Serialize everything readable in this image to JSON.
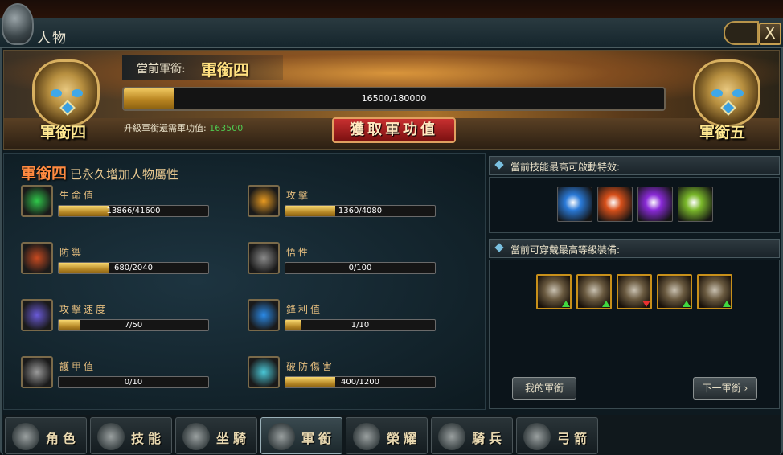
{
  "window": {
    "title": "人物",
    "close_label": "X"
  },
  "header": {
    "current_rank_label": "當前軍銜:",
    "current_rank_value": "軍銜四",
    "left_emblem_label": "軍銜四",
    "right_emblem_label": "軍銜五",
    "progress": {
      "current": 16500,
      "max": 180000,
      "text": "16500/180000"
    },
    "need_label": "升級軍銜還需軍功值:",
    "need_value": "163500",
    "get_button": "獲取軍功值"
  },
  "stats_panel": {
    "rank": "軍銜四",
    "title_suffix": "已永久增加人物屬性",
    "stats": [
      {
        "label": "生命值",
        "text": "13866/41600",
        "current": 13866,
        "max": 41600,
        "icon": "life-icon",
        "color": "#2fc84a"
      },
      {
        "label": "攻擊",
        "text": "1360/4080",
        "current": 1360,
        "max": 4080,
        "icon": "attack-icon",
        "color": "#e89a20"
      },
      {
        "label": "防禦",
        "text": "680/2040",
        "current": 680,
        "max": 2040,
        "icon": "defense-icon",
        "color": "#c84a20"
      },
      {
        "label": "悟性",
        "text": "0/100",
        "current": 0,
        "max": 100,
        "icon": "insight-icon",
        "color": "#8a8a8a"
      },
      {
        "label": "攻擊速度",
        "text": "7/50",
        "current": 7,
        "max": 50,
        "icon": "attack-speed-icon",
        "color": "#6a5ad8"
      },
      {
        "label": "鋒利值",
        "text": "1/10",
        "current": 1,
        "max": 10,
        "icon": "sharpness-icon",
        "color": "#2a8ae8"
      },
      {
        "label": "護甲值",
        "text": "0/10",
        "current": 0,
        "max": 10,
        "icon": "armor-icon",
        "color": "#9a9a9a"
      },
      {
        "label": "破防傷害",
        "text": "400/1200",
        "current": 400,
        "max": 1200,
        "icon": "pierce-damage-icon",
        "color": "#4ac8d8"
      }
    ]
  },
  "skills_section": {
    "title": "當前技能最高可啟動特效:",
    "skills": [
      {
        "icon": "blue-blade-skill-icon",
        "color": "#2a7ad8"
      },
      {
        "icon": "fire-strike-skill-icon",
        "color": "#d8501a"
      },
      {
        "icon": "shadow-skill-icon",
        "color": "#8a2ad8"
      },
      {
        "icon": "wind-slash-skill-icon",
        "color": "#7ab82a"
      }
    ]
  },
  "equipment_section": {
    "title": "當前可穿戴最高等級裝備:",
    "items": [
      {
        "icon": "weapon-equip-icon",
        "arrow": "up"
      },
      {
        "icon": "armor-equip-icon",
        "arrow": "up"
      },
      {
        "icon": "helmet-equip-icon",
        "arrow": "down"
      },
      {
        "icon": "ring-equip-icon",
        "arrow": "up"
      },
      {
        "icon": "boots-equip-icon",
        "arrow": "up"
      }
    ],
    "my_rank_button": "我的軍銜",
    "next_rank_button": "下一軍銜"
  },
  "tabs": [
    {
      "label": "角色",
      "icon": "character-tab-icon"
    },
    {
      "label": "技能",
      "icon": "skill-tab-icon"
    },
    {
      "label": "坐騎",
      "icon": "mount-tab-icon"
    },
    {
      "label": "軍銜",
      "icon": "rank-tab-icon",
      "active": true
    },
    {
      "label": "榮耀",
      "icon": "honor-tab-icon"
    },
    {
      "label": "騎兵",
      "icon": "cavalry-tab-icon"
    },
    {
      "label": "弓箭",
      "icon": "archery-tab-icon"
    }
  ]
}
